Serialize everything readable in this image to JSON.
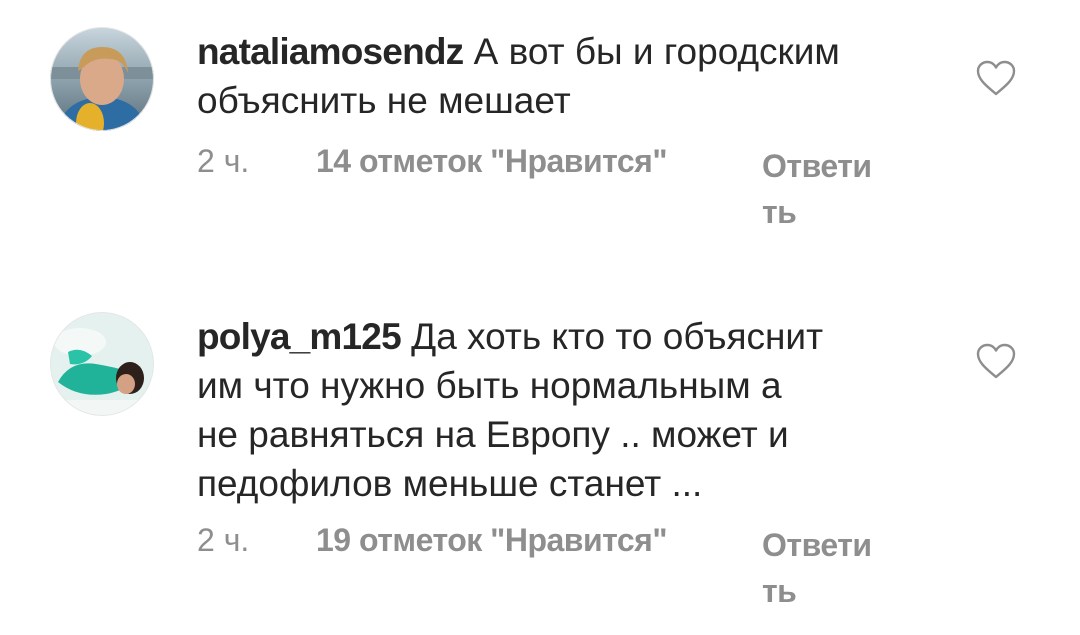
{
  "comments": [
    {
      "username": "nataliamosendz",
      "text": "А вот бы и городским\nобъяснить не мешает",
      "time": "2 ч.",
      "likes": "14 отметок \"Нравится\"",
      "reply": "Ответи\nть",
      "avatar_icon": "profile-photo",
      "like_icon": "heart-outline-icon"
    },
    {
      "username": "polya_m125",
      "text": "Да хоть кто то объяснит\nим что нужно быть нормальным а\nне равняться на Европу .. может и\nпедофилов меньше станет ...",
      "time": "2 ч.",
      "likes": "19 отметок \"Нравится\"",
      "reply": "Ответи\nть",
      "avatar_icon": "profile-photo",
      "like_icon": "heart-outline-icon"
    }
  ],
  "colors": {
    "primary_text": "#262626",
    "secondary_text": "#8e8e8e",
    "background": "#ffffff"
  }
}
